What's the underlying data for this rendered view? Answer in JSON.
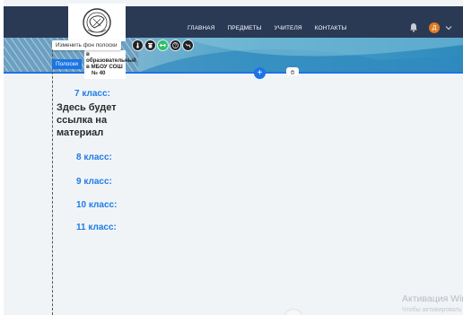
{
  "navbar": {
    "links": [
      "ГЛАВНАЯ",
      "ПРЕДМЕТЫ",
      "УЧИТЕЛЯ",
      "КОНТАКТЫ"
    ],
    "avatar_letter": "Д",
    "bg_color": "#2a3a55"
  },
  "editor": {
    "tooltip": "Изменить фон полоски",
    "stripes_tab": "Полоски",
    "info_card_lines": [
      "в образовательный",
      "в МБОУ СОШ",
      "№ 40"
    ]
  },
  "content": {
    "grade7": "7 класс:",
    "placeholder": "Здесь будет ссылка на материал",
    "grade8": "8 класс:",
    "grade9": "9 класс:",
    "grade10": "10 класс:",
    "grade11": "11 класс:"
  },
  "watermark": {
    "title": "Активация Wind",
    "subtitle": "Чтобы активировать"
  },
  "colors": {
    "accent": "#1e73e8",
    "link": "#1e7be6",
    "toolbar_green": "#2dbf6a",
    "avatar": "#e07a1f"
  },
  "icons": [
    "logo-emblem",
    "bell-icon",
    "chevron-down-icon",
    "thermometer-icon",
    "trash-icon",
    "resize-icon",
    "help-icon",
    "link-icon",
    "plus-icon",
    "collapse-icon"
  ]
}
